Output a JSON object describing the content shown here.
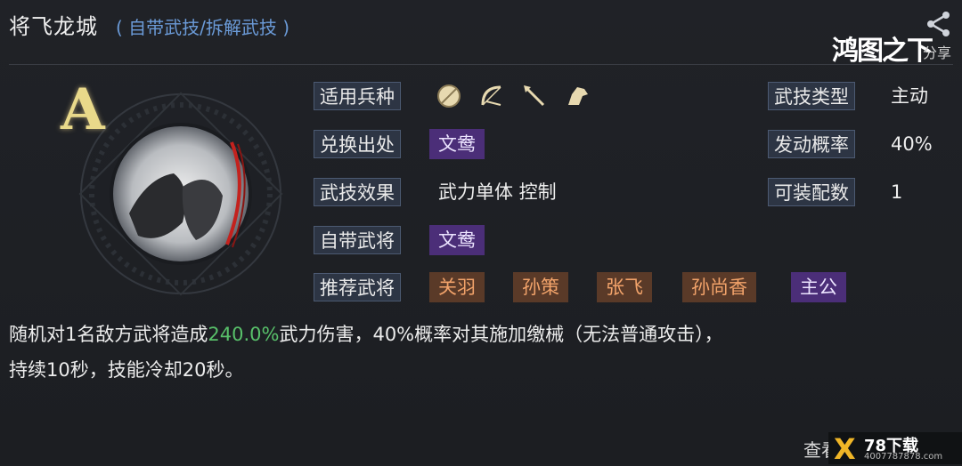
{
  "header": {
    "title": "将飞龙城",
    "subtitle": "( 自带武技/拆解武技 )",
    "share_label": "分享",
    "brand": "鸿图之下"
  },
  "skill": {
    "grade": "A"
  },
  "rows": {
    "troop_label": "适用兵种",
    "troop_icons": [
      "shield-icon",
      "bow-icon",
      "spear-icon",
      "horse-icon"
    ],
    "exchange_label": "兑换出处",
    "exchange_value": "文鸯",
    "effect_label": "武技效果",
    "effect_value": "武力单体 控制",
    "own_general_label": "自带武将",
    "own_general_value": "文鸯",
    "recommend_label": "推荐武将",
    "recommend_values": [
      "关羽",
      "孙策",
      "张飞",
      "孙尚香",
      "主公"
    ],
    "type_label": "武技类型",
    "type_value": "主动",
    "chance_label": "发动概率",
    "chance_value": "40%",
    "slots_label": "可装配数",
    "slots_value": "1"
  },
  "description": {
    "part1": "随机对1名敌方武将造成",
    "highlight": "240.0%",
    "part2": "武力伤害，40%概率对其施加缴械（无法普通攻击），",
    "line2": "持续10秒，技能冷却20秒。"
  },
  "footer": {
    "view_more": "查看",
    "watermark_title": "78下载",
    "watermark_sub": "4007787878.com"
  },
  "colors": {
    "label_bg": "#2d3544",
    "tag_purple": "#4b2e78",
    "tag_orange": "#5a3a28",
    "highlight_green": "#58c06a",
    "subtitle_blue": "#6b9bd8"
  }
}
